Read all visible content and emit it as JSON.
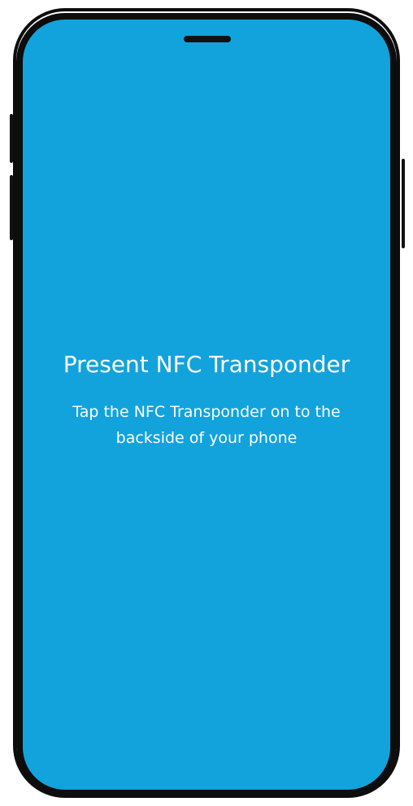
{
  "screen": {
    "title": "Present NFC Transponder",
    "subtitle": "Tap the NFC Transponder on to the backside of your phone",
    "background_color": "#12a3dd",
    "text_color": "#ffffff"
  },
  "device": {
    "frame_color": "#0d0d0d",
    "speaker_icon": "speaker-grille-icon"
  }
}
